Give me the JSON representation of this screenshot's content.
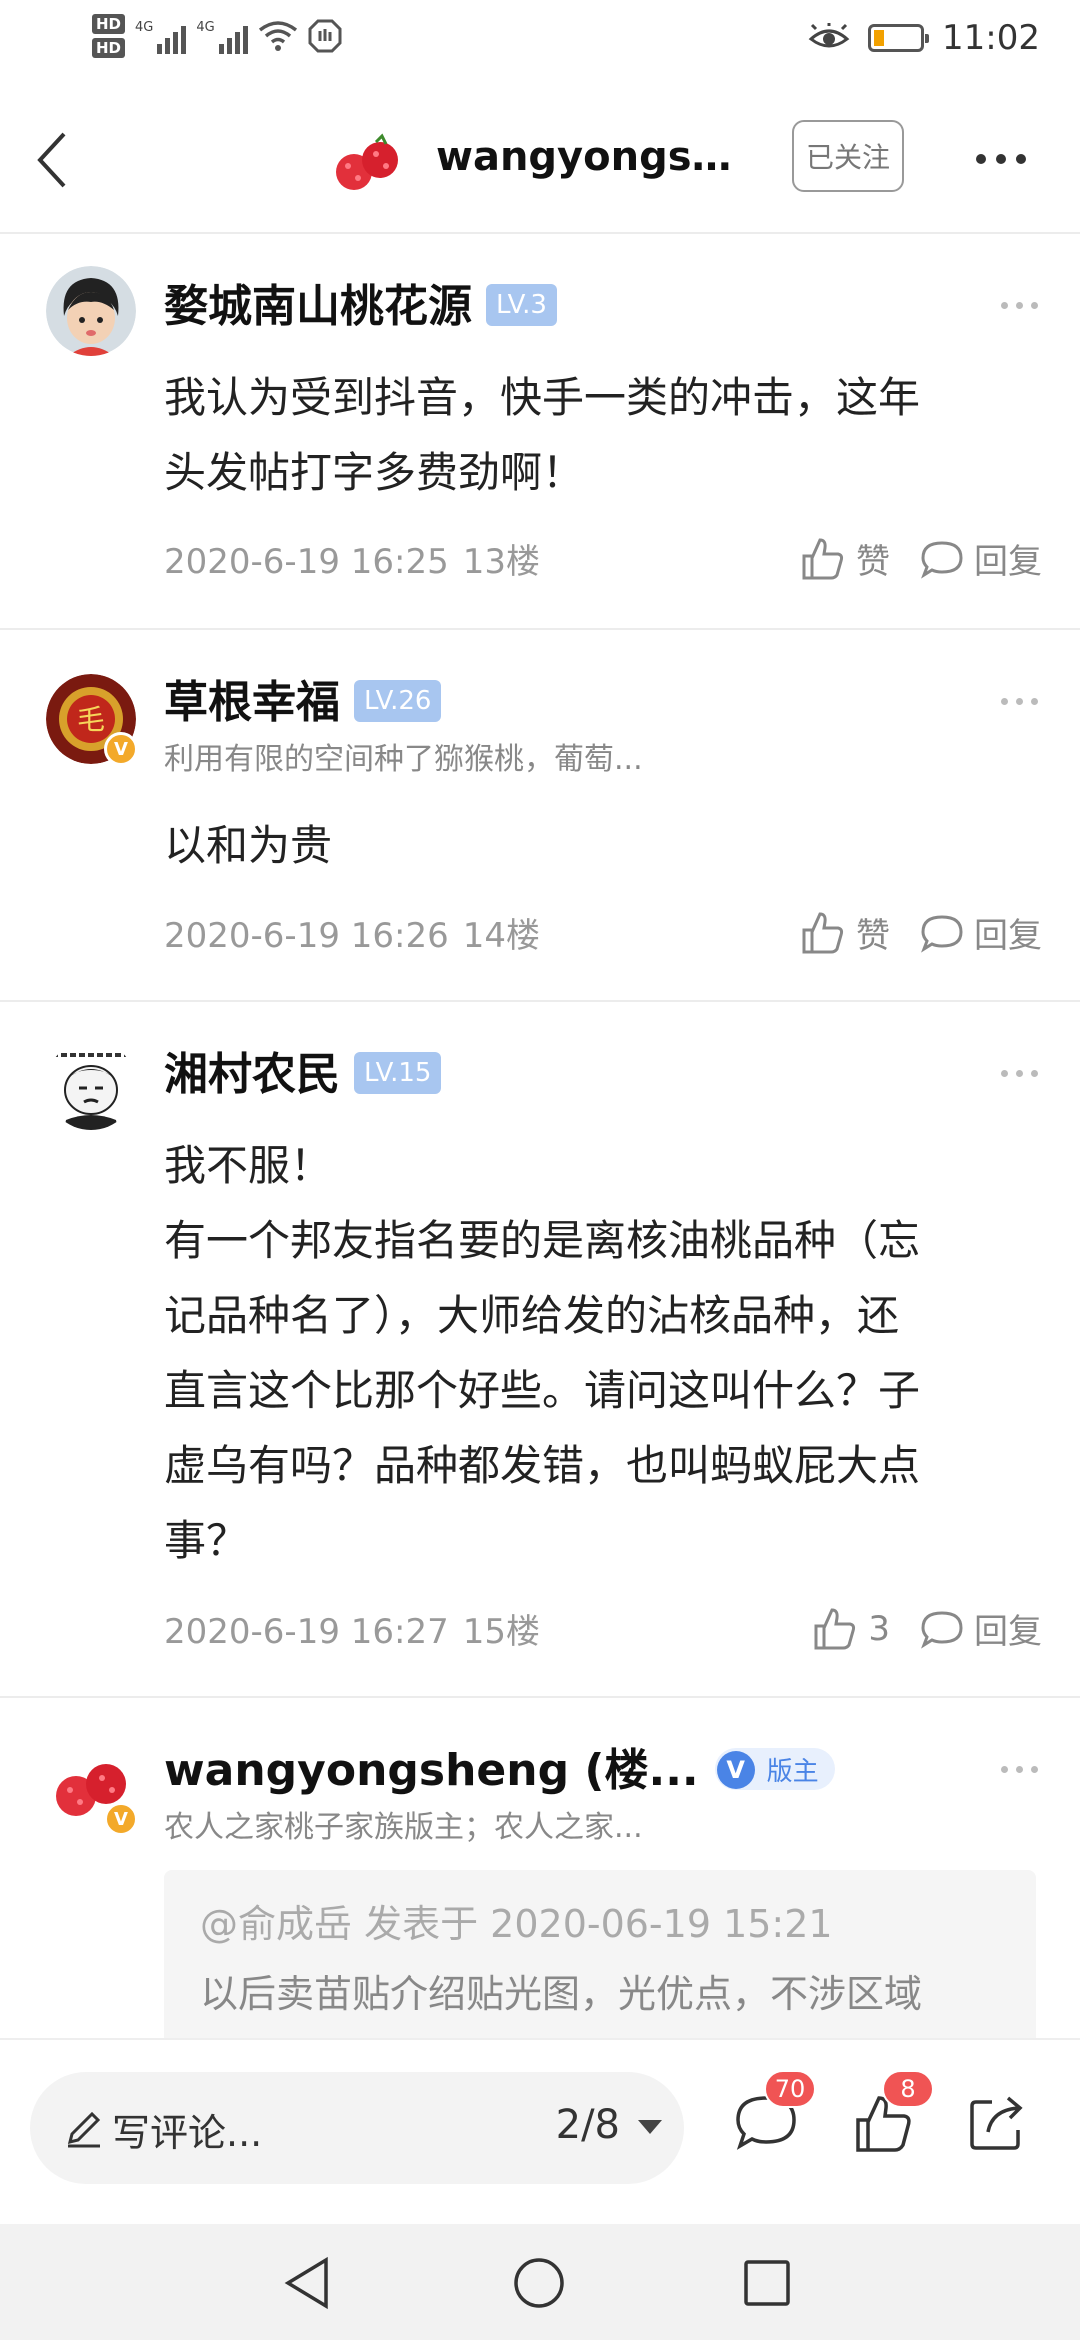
{
  "status_bar": {
    "hd1": "HD",
    "hd2": "HD",
    "net1": "4G",
    "net2": "4G",
    "time": "11:02"
  },
  "header": {
    "title": "wangyongsh...",
    "follow_label": "已关注"
  },
  "comments": [
    {
      "username": "婺城南山桃花源",
      "level": "LV.3",
      "signature": "",
      "text_lines": [
        "我认为受到抖音，快手一类的冲击，这年",
        "头发帖打字多费劲啊！"
      ],
      "date": "2020-6-19 16:25",
      "floor": "13楼",
      "like_label": "赞",
      "reply_label": "回复"
    },
    {
      "username": "草根幸福",
      "level": "LV.26",
      "signature": "利用有限的空间种了猕猴桃，葡萄...",
      "text_lines": [
        "以和为贵"
      ],
      "date": "2020-6-19 16:26",
      "floor": "14楼",
      "like_label": "赞",
      "reply_label": "回复"
    },
    {
      "username": "湘村农民",
      "level": "LV.15",
      "signature": "",
      "text_lines": [
        "我不服！",
        "有一个邦友指名要的是离核油桃品种（忘",
        "记品种名了），大师给发的沾核品种，还",
        "直言这个比那个好些。请问这叫什么？子",
        "虚乌有吗？品种都发错，也叫蚂蚁屁大点",
        "事？"
      ],
      "date": "2020-6-19 16:27",
      "floor": "15楼",
      "like_label": "3",
      "reply_label": "回复"
    },
    {
      "username": "wangyongsheng (楼...",
      "mod_badge": "版主",
      "mod_v": "V",
      "signature": "农人之家桃子家族版主；农人之家...",
      "quote_header": "@俞成岳 发表于 2020-06-19 15:21",
      "quote_text": "以后卖苗贴介绍贴光图，光优点，不涉区域"
    }
  ],
  "bottom_bar": {
    "comment_placeholder": "写评论...",
    "page_indicator": "2/8",
    "comments_count": "70",
    "likes_count": "8"
  },
  "avatar_text": {
    "c2": "毛",
    "verified_v": "V"
  },
  "colors": {
    "level_badge": "#a8c6f0",
    "verified": "#f3a92a",
    "notification_badge": "#f05454",
    "moderator_blue": "#4a84e6"
  }
}
